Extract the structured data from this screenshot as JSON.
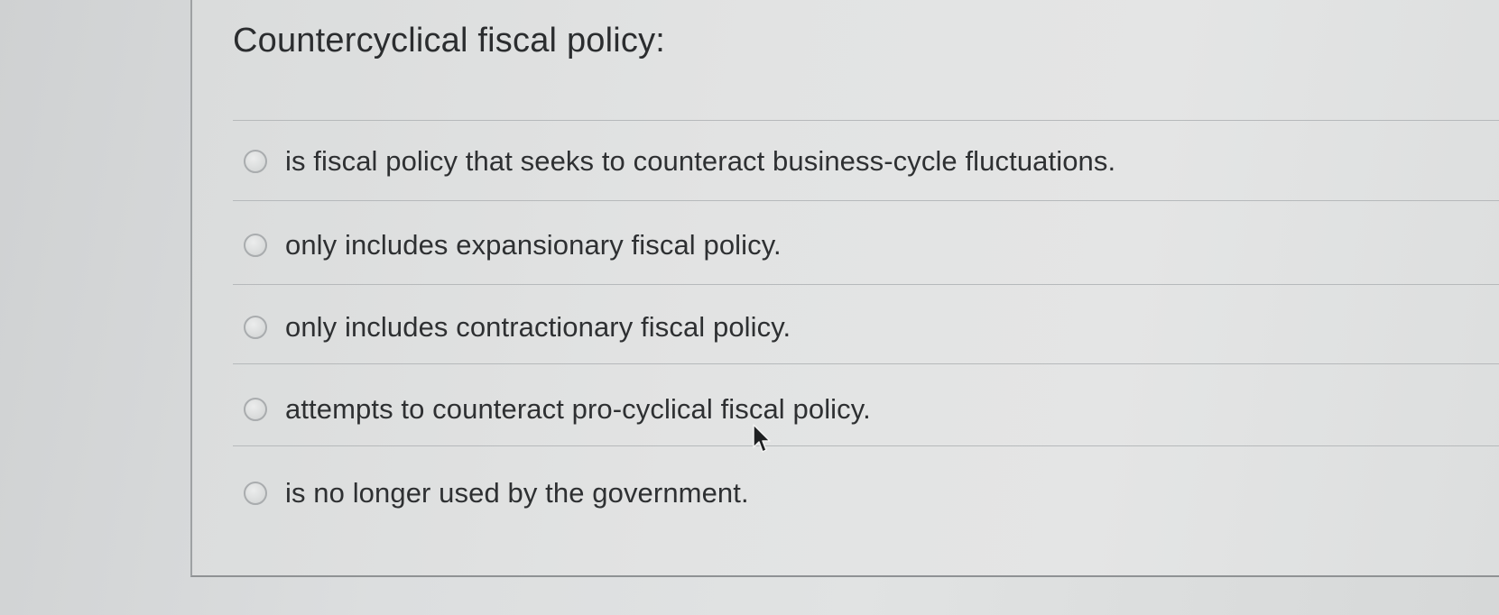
{
  "question": {
    "title": "Countercyclical fiscal policy:"
  },
  "options": [
    {
      "label": "is fiscal policy that seeks to counteract business-cycle fluctuations.",
      "selected": false
    },
    {
      "label": "only includes expansionary fiscal policy.",
      "selected": false
    },
    {
      "label": "only includes contractionary fiscal policy.",
      "selected": false
    },
    {
      "label": "attempts to counteract pro-cyclical fiscal policy.",
      "selected": false
    },
    {
      "label": "is no longer used by the government.",
      "selected": false
    }
  ],
  "colors": {
    "background": "#d9dbdc",
    "panel": "#e2e3e3",
    "text": "#2e3032",
    "divider": "#b6b9bb",
    "radio_border": "#a9acae"
  },
  "icons": {
    "pointer": "mouse-pointer-icon"
  }
}
